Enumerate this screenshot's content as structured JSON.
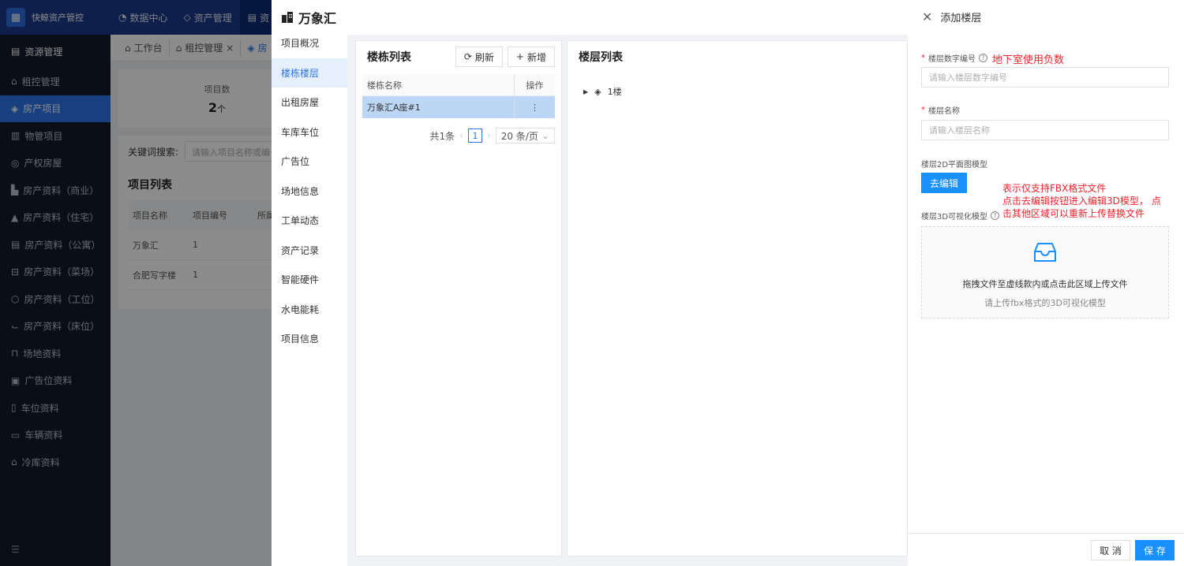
{
  "app": {
    "logo_text": "快鲸资产管控",
    "top_nav": [
      "数据中心",
      "资产管理",
      "资"
    ],
    "sidebar_header": "资源管理",
    "sidebar_items": [
      "租控管理",
      "房产项目",
      "物管项目",
      "产权房屋",
      "房产资料（商业）",
      "房产资料（住宅）",
      "房产资料（公寓）",
      "房产资料（菜场）",
      "房产资料（工位）",
      "房产资料（床位）",
      "场地资料",
      "广告位资料",
      "车位资料",
      "车辆资料",
      "冷库资料"
    ],
    "tabs": [
      "工作台",
      "租控管理",
      "房"
    ],
    "stats": {
      "label": "项目数",
      "value": "2",
      "unit": "个"
    },
    "search_label": "关键词搜索:",
    "search_placeholder": "请输入项目名称或编号",
    "list_title": "项目列表",
    "table_headers": [
      "项目名称",
      "项目编号",
      "所属"
    ],
    "table_rows": [
      [
        "万象汇",
        "1"
      ],
      [
        "合肥写字楼",
        "1"
      ]
    ]
  },
  "project": {
    "title": "万象汇",
    "nav": [
      "项目概况",
      "楼栋楼层",
      "出租房屋",
      "车库车位",
      "广告位",
      "场地信息",
      "工单动态",
      "资产记录",
      "智能硬件",
      "水电能耗",
      "项目信息"
    ],
    "buildings": {
      "title": "楼栋列表",
      "refresh_label": "刷新",
      "add_label": "新增",
      "col_name": "楼栋名称",
      "col_op": "操作",
      "rows": [
        {
          "name": "万象汇A座#1",
          "op": "⋮"
        }
      ],
      "total": "共1条",
      "page": "1",
      "page_size": "20 条/页"
    },
    "floors": {
      "title": "楼层列表",
      "items": [
        "1楼"
      ]
    }
  },
  "drawer": {
    "title": "添加楼层",
    "floor_number": {
      "label": "楼层数字编号",
      "note": "地下室使用负数",
      "placeholder": "请输入楼层数字编号"
    },
    "floor_name": {
      "label": "楼层名称",
      "placeholder": "请输入楼层名称"
    },
    "plan_2d": {
      "label": "楼层2D平面图模型",
      "button": "去编辑"
    },
    "note_lines": [
      "表示仅支持FBX格式文件",
      "点击去编辑按钮进入编辑3D模型， 点",
      "击其他区域可以重新上传替换文件"
    ],
    "model_3d": {
      "label": "楼层3D可视化模型",
      "upload_main": "拖拽文件至虚线款内或点击此区域上传文件",
      "upload_sub": "请上传fbx格式的3D可视化模型"
    },
    "cancel_label": "取 消",
    "save_label": "保 存"
  }
}
